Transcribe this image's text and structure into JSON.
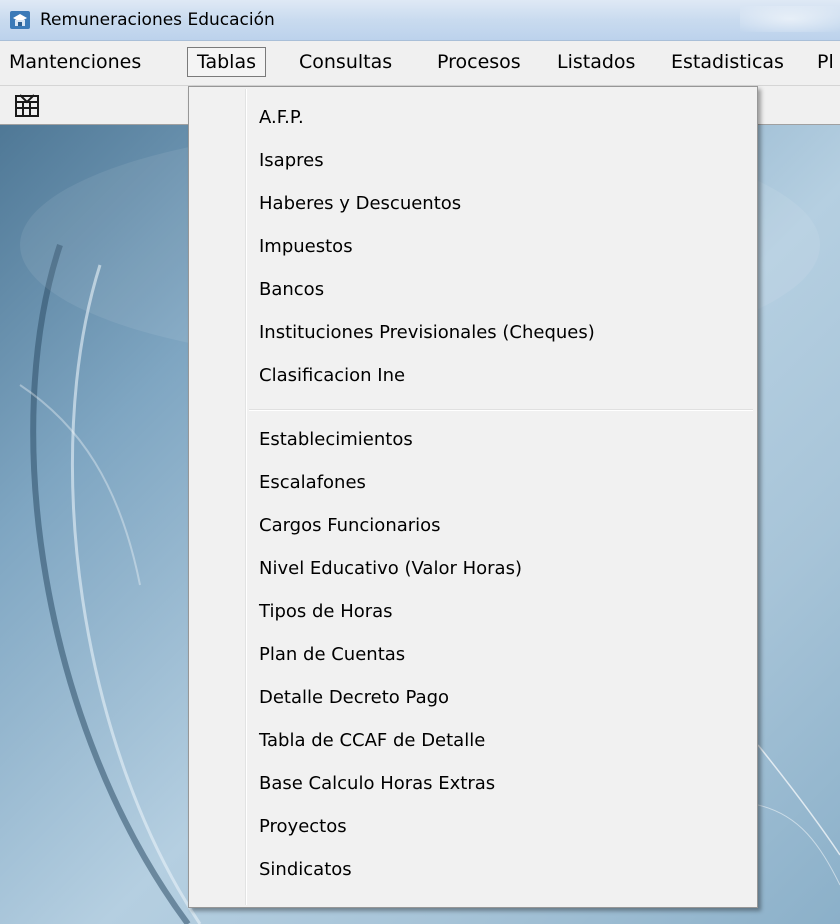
{
  "window": {
    "title": "Remuneraciones Educación"
  },
  "menubar": {
    "items": [
      "Mantenciones",
      "Tablas",
      "Consultas",
      "Procesos",
      "Listados",
      "Estadisticas",
      "Pl"
    ],
    "active": "Tablas"
  },
  "toolbar": {
    "buttons": [
      {
        "icon": "grid-table-icon"
      }
    ]
  },
  "dropdown": {
    "group1": [
      "A.F.P.",
      "Isapres",
      "Haberes y Descuentos",
      "Impuestos",
      "Bancos",
      "Instituciones Previsionales (Cheques)",
      "Clasificacion Ine"
    ],
    "group2": [
      "Establecimientos",
      "Escalafones",
      "Cargos Funcionarios",
      "Nivel Educativo (Valor Horas)",
      "Tipos de Horas",
      "Plan de Cuentas",
      "Detalle Decreto Pago",
      "Tabla de CCAF de Detalle",
      "Base Calculo Horas Extras",
      "Proyectos",
      "Sindicatos"
    ]
  },
  "colors": {
    "titlebar": "#c9dbef",
    "menubar": "#f0f0f0",
    "menu_panel": "#f1f1f1",
    "background_accent": "#7fa6c2"
  }
}
